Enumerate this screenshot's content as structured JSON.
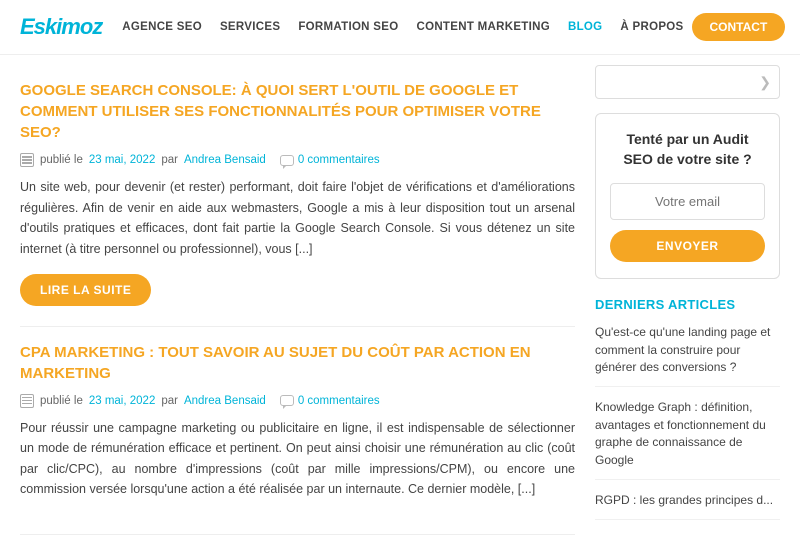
{
  "header": {
    "logo": "Eskimoz",
    "nav": [
      {
        "label": "AGENCE SEO",
        "active": false
      },
      {
        "label": "SERVICES",
        "active": false
      },
      {
        "label": "FORMATION SEO",
        "active": false
      },
      {
        "label": "CONTENT MARKETING",
        "active": false
      },
      {
        "label": "BLOG",
        "active": true
      },
      {
        "label": "À PROPOS",
        "active": false
      }
    ],
    "contact_label": "CONTACT"
  },
  "articles": [
    {
      "title": "GOOGLE SEARCH CONSOLE: À QUOI SERT L'OUTIL DE GOOGLE ET COMMENT UTILISER SES FONCTIONNALITÉS POUR OPTIMISER VOTRE SEO?",
      "published_prefix": "publié le",
      "date": "23 mai, 2022",
      "by": "par",
      "author": "Andrea Bensaid",
      "comments": "0 commentaires",
      "text": "Un site web, pour devenir (et rester) performant, doit faire l'objet de vérifications et d'améliorations régulières. Afin de venir en aide aux webmasters, Google a mis à leur disposition tout un arsenal d'outils pratiques et efficaces, dont fait partie la Google Search Console. Si vous détenez un site internet (à titre personnel ou professionnel), vous [...]",
      "read_more": "LIRE LA SUITE"
    },
    {
      "title": "CPA MARKETING : TOUT SAVOIR AU SUJET DU COÛT PAR ACTION EN MARKETING",
      "published_prefix": "publié le",
      "date": "23 mai, 2022",
      "by": "par",
      "author": "Andrea Bensaid",
      "comments": "0 commentaires",
      "text": "Pour réussir une campagne marketing ou publicitaire en ligne, il est indispensable de sélectionner un mode de rémunération efficace et pertinent. On peut ainsi choisir une rémunération au clic (coût par clic/CPC), au nombre d'impressions (coût par mille impressions/CPM), ou encore une commission versée lorsqu'une action a été réalisée par un internaute. Ce dernier modèle, [...]"
    }
  ],
  "sidebar": {
    "search_placeholder": "",
    "audit_title": "Tenté par un Audit SEO de votre site ?",
    "email_placeholder": "Votre email",
    "envoyer_label": "ENVOYER",
    "derniers_title": "DERNIERS ARTICLES",
    "derniers": [
      "Qu'est-ce qu'une landing page et comment la construire pour générer des conversions ?",
      "Knowledge Graph : définition, avantages et fonctionnement du graphe de connaissance de Google",
      "RGPD : les grandes principes d..."
    ]
  }
}
